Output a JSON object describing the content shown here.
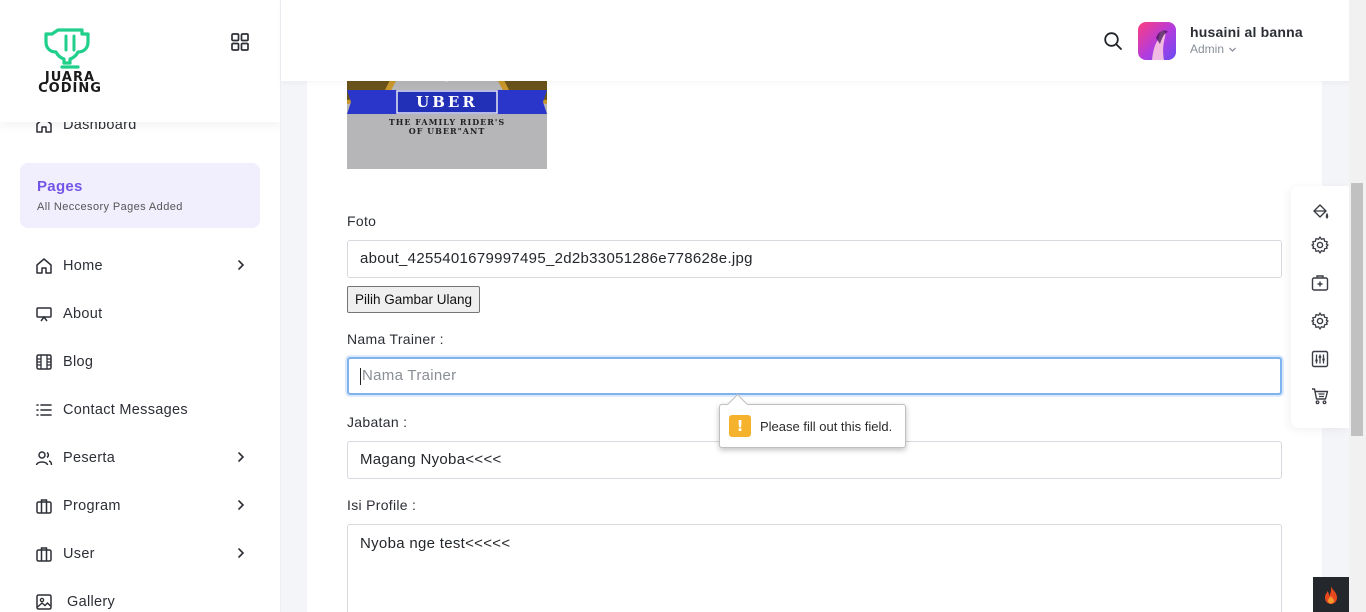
{
  "brand": {
    "logo_line1": "JUARA",
    "logo_line2": "CODING"
  },
  "sidebar": {
    "dashboard": "Dashboard",
    "pages": {
      "title": "Pages",
      "subtitle": "All Neccesory Pages Added"
    },
    "items": [
      {
        "label": "Home",
        "icon": "home-icon",
        "has_submenu": true
      },
      {
        "label": "About",
        "icon": "presentation-icon",
        "has_submenu": false
      },
      {
        "label": "Blog",
        "icon": "film-icon",
        "has_submenu": false
      },
      {
        "label": "Contact Messages",
        "icon": "list-icon",
        "has_submenu": false
      },
      {
        "label": "Peserta",
        "icon": "users-icon",
        "has_submenu": true
      },
      {
        "label": "Program",
        "icon": "briefcase-icon",
        "has_submenu": true
      },
      {
        "label": "User",
        "icon": "briefcase-icon",
        "has_submenu": true
      },
      {
        "label": "Gallery",
        "icon": "image-icon",
        "has_submenu": false
      }
    ]
  },
  "header": {
    "user_name": "husaini al banna",
    "user_role": "Admin"
  },
  "form": {
    "photo_banner_text": "UBER",
    "photo_tagline_1": "THE FAMILY RIDER'S",
    "photo_tagline_2": "OF UBER\"ANT",
    "foto_label": "Foto",
    "foto_value": "about_4255401679997495_2d2b33051286e778628e.jpg",
    "choose_button": "Pilih Gambar Ulang",
    "nama_label": "Nama Trainer :",
    "nama_placeholder": "Nama Trainer",
    "jabatan_label": "Jabatan :",
    "jabatan_value": "Magang Nyoba<<<<",
    "profile_label": "Isi Profile :",
    "profile_value": "Nyoba nge test<<<<<"
  },
  "validation": {
    "message": "Please fill out this field."
  },
  "colors": {
    "accent": "#7356e8",
    "brand_green": "#1fcf8a",
    "focus_border": "#7fb3f0",
    "warning": "#f5b32d"
  }
}
